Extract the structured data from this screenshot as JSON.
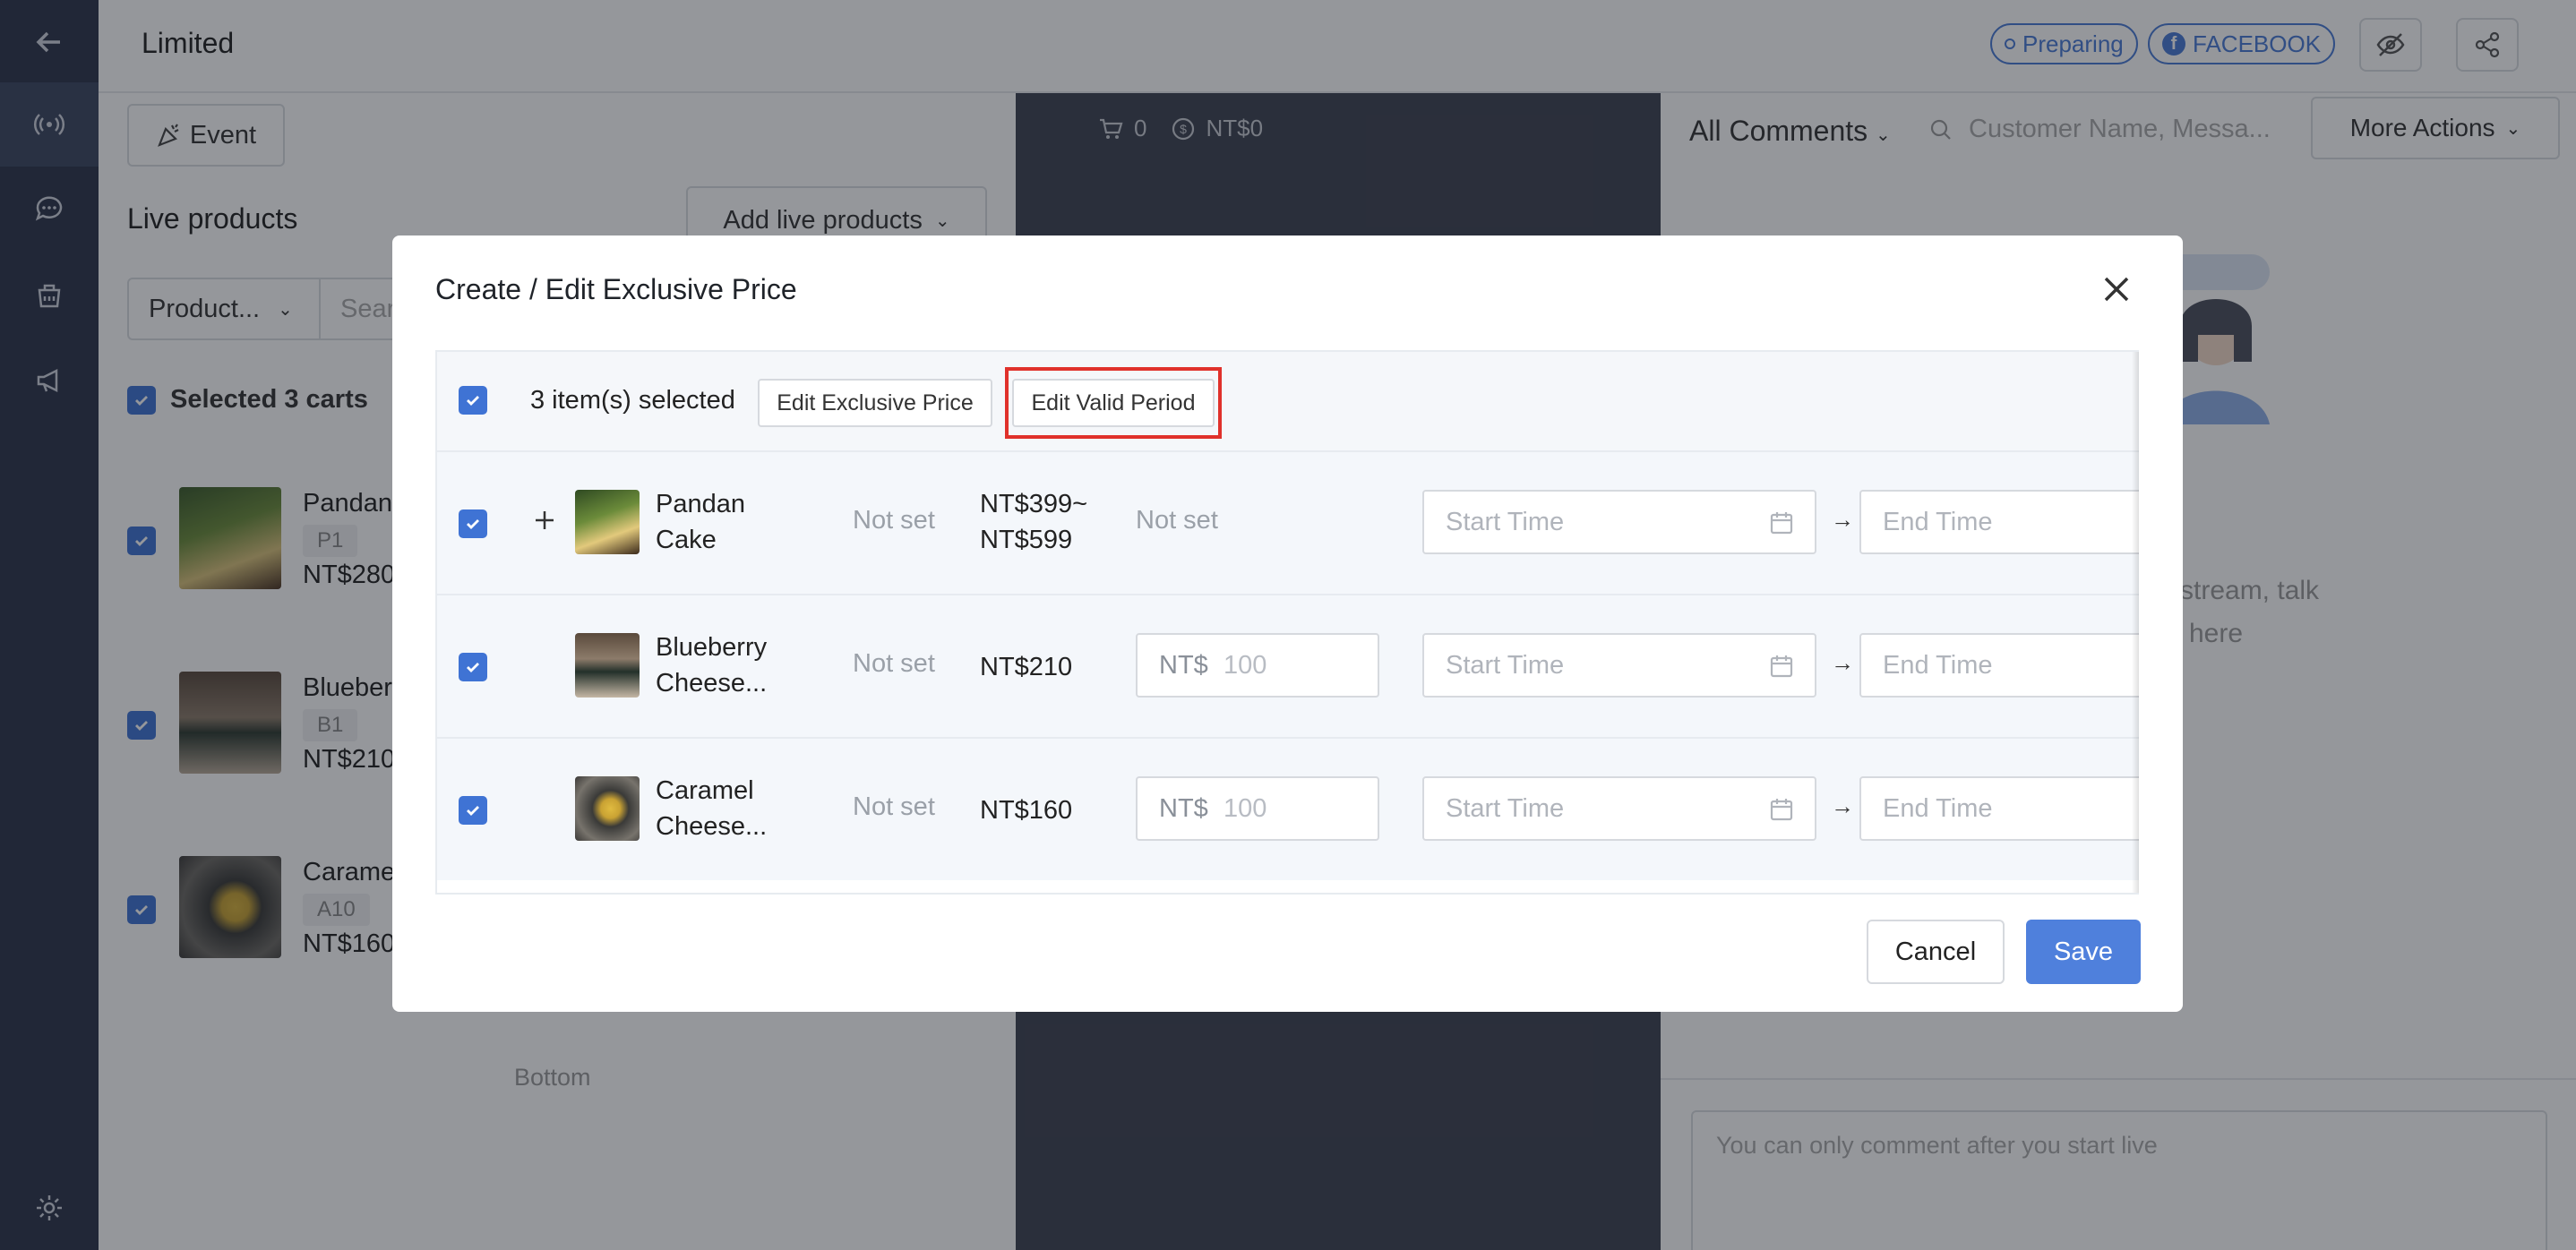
{
  "app": {
    "title": "Limited",
    "status_badge": "Preparing",
    "platform_badge": "FACEBOOK"
  },
  "left_panel": {
    "event_label": "Event",
    "title": "Live products",
    "add_button": "Add live products",
    "filter_label": "Product...",
    "search_placeholder": "Sear",
    "selected_label": "Selected 3 carts",
    "items": [
      {
        "name": "Pandan",
        "tag": "P1",
        "price": "NT$280"
      },
      {
        "name": "Bluebern",
        "tag": "B1",
        "price": "NT$210"
      },
      {
        "name": "Caramel",
        "tag": "A10",
        "price": "NT$160"
      }
    ],
    "bottom_text": "Bottom"
  },
  "center_panel": {
    "cart_count": "0",
    "cart_total": "NT$0"
  },
  "right_panel": {
    "filter_label": "All Comments",
    "search_placeholder": "Customer Name, Messa...",
    "more_actions": "More Actions",
    "empty_line1": "stream, talk",
    "empty_line2": "here",
    "comment_placeholder": "You can only comment after you start live"
  },
  "modal": {
    "title": "Create / Edit Exclusive Price",
    "selected_count": "3 item(s) selected",
    "edit_price_button": "Edit Exclusive Price",
    "edit_period_button": "Edit Valid Period",
    "rows": [
      {
        "name_line1": "Pandan",
        "name_line2": "Cake",
        "col_a": "Not set",
        "price_line1": "NT$399~",
        "price_line2": "NT$599",
        "exclusive": "Not set",
        "start": "Start Time",
        "end": "End Time"
      },
      {
        "name_line1": "Blueberry",
        "name_line2": "Cheese...",
        "col_a": "Not set",
        "price": "NT$210",
        "currency": "NT$",
        "exclusive_value": "100",
        "start": "Start Time",
        "end": "End Time"
      },
      {
        "name_line1": "Caramel",
        "name_line2": "Cheese...",
        "col_a": "Not set",
        "price": "NT$160",
        "currency": "NT$",
        "exclusive_value": "100",
        "start": "Start Time",
        "end": "End Time"
      }
    ],
    "cancel_button": "Cancel",
    "save_button": "Save"
  },
  "colors": {
    "accent": "#4f80dc",
    "highlight": "#e0312b",
    "rail": "#2c3449"
  }
}
